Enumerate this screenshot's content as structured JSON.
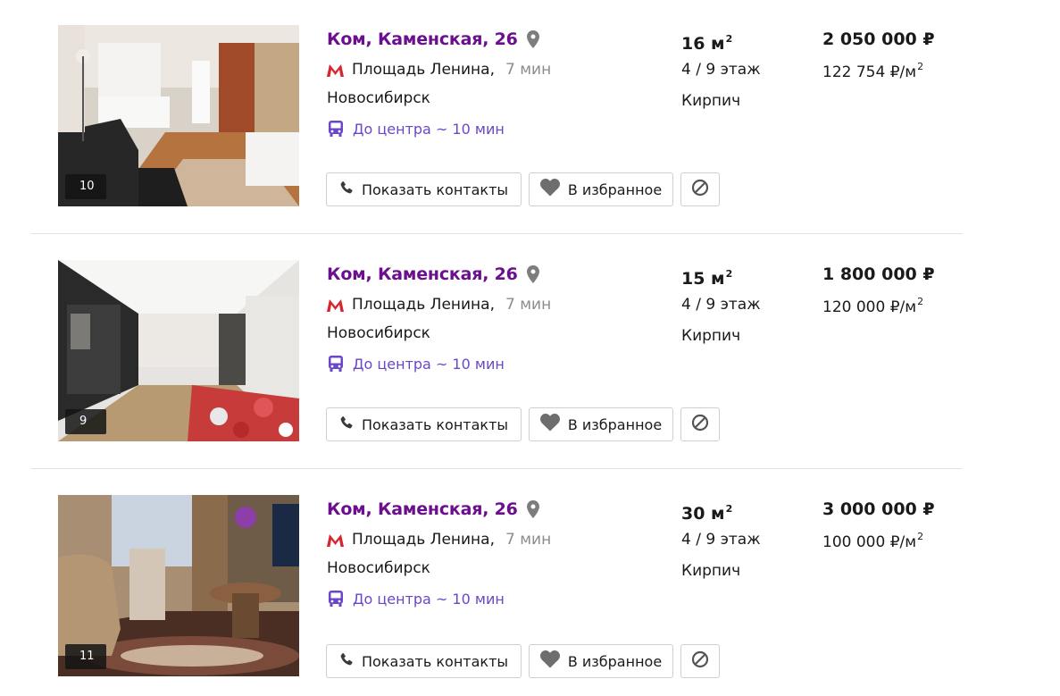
{
  "listings": [
    {
      "title": "Ком, Каменская, 26",
      "metro": "Площадь Ленина,",
      "metro_time": "7 мин",
      "city": "Новосибирск",
      "transit": "До центра ~ 10 мин",
      "area_value": "16 м",
      "area_unit_sup": "2",
      "floor": "4 / 9 этаж",
      "material": "Кирпич",
      "price": "2 050 000 ₽",
      "price_per_m_value": "122 754 ₽/м",
      "price_per_m_sup": "2",
      "photo_count": "10"
    },
    {
      "title": "Ком, Каменская, 26",
      "metro": "Площадь Ленина,",
      "metro_time": "7 мин",
      "city": "Новосибирск",
      "transit": "До центра ~ 10 мин",
      "area_value": "15 м",
      "area_unit_sup": "2",
      "floor": "4 / 9 этаж",
      "material": "Кирпич",
      "price": "1 800 000 ₽",
      "price_per_m_value": "120 000 ₽/м",
      "price_per_m_sup": "2",
      "photo_count": "9"
    },
    {
      "title": "Ком, Каменская, 26",
      "metro": "Площадь Ленина,",
      "metro_time": "7 мин",
      "city": "Новосибирск",
      "transit": "До центра ~ 10 мин",
      "area_value": "30 м",
      "area_unit_sup": "2",
      "floor": "4 / 9 этаж",
      "material": "Кирпич",
      "price": "3 000 000 ₽",
      "price_per_m_value": "100 000 ₽/м",
      "price_per_m_sup": "2",
      "photo_count": "11"
    }
  ],
  "buttons": {
    "contacts_label": "Показать контакты",
    "favorite_label": "В избранное"
  },
  "icons": {
    "pin": "map-pin-icon",
    "metro": "metro-icon",
    "transit": "bus-icon",
    "phone": "phone-icon",
    "heart": "heart-icon",
    "block": "block-icon"
  },
  "colors": {
    "title": "#6b0f8f",
    "metro": "#d6262f",
    "transit": "#6a47c7",
    "muted": "#8c8c8c"
  }
}
